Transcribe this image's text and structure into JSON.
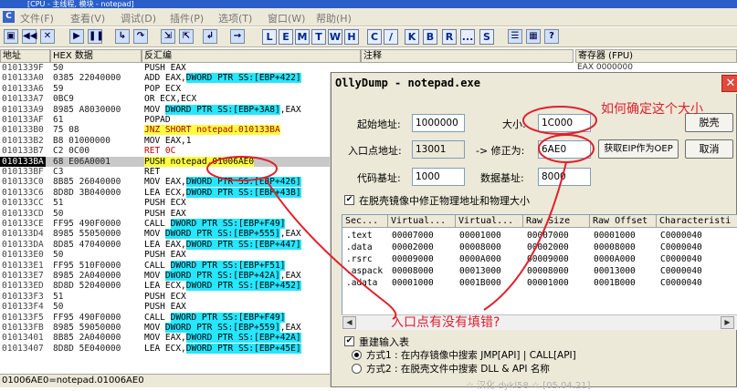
{
  "app_title": "[CPU - 主线程, 模块 - notepad]",
  "menu": [
    "文件(F)",
    "查看(V)",
    "调试(D)",
    "插件(P)",
    "选项(T)",
    "窗口(W)",
    "帮助(H)"
  ],
  "toolbar_letters": [
    "L",
    "E",
    "M",
    "T",
    "W",
    "H",
    "C",
    "/",
    "K",
    "B",
    "R",
    "...",
    "S"
  ],
  "columns": {
    "addr": "地址",
    "hex": "HEX 数据",
    "dis": "反汇编",
    "comment": "注释",
    "reg": "寄存器 (FPU)"
  },
  "reg_first": "EAX 0000000",
  "rows": [
    {
      "a": "0101339F",
      "h": "50",
      "d": "PUSH EAX"
    },
    {
      "a": "010133A0",
      "h": "0385 22040000",
      "d": "ADD EAX,",
      "dh": "DWORD PTR SS:[EBP+422]"
    },
    {
      "a": "010133A6",
      "h": "59",
      "d": "POP ECX"
    },
    {
      "a": "010133A7",
      "h": "0BC9",
      "d": "OR ECX,ECX"
    },
    {
      "a": "010133A9",
      "h": "8985 A8030000",
      "d": "MOV ",
      "dh": "DWORD PTR SS:[EBP+3A8]",
      "dt": ",EAX"
    },
    {
      "a": "010133AF",
      "h": "61",
      "d": "POPAD"
    },
    {
      "a": "010133B0",
      "h": "75 08",
      "d": "JNZ SHORT notepad.010133BA",
      "y": true
    },
    {
      "a": "010133B2",
      "h": "B8 01000000",
      "d": "MOV EAX,1"
    },
    {
      "a": "010133B7",
      "h": "C2 0C00",
      "d": "RET 0C",
      "red": true
    },
    {
      "a": "010133BA",
      "h": "68 E06A0001",
      "d": "PUSH notepad.01006AE0",
      "sel": true
    },
    {
      "a": "010133BF",
      "h": "C3",
      "d": "RET"
    },
    {
      "a": "010133C0",
      "h": "8B85 26040000",
      "d": "MOV EAX,",
      "dh": "DWORD PTR SS:[EBP+426]"
    },
    {
      "a": "010133C6",
      "h": "8D8D 3B040000",
      "d": "LEA ECX,",
      "dh": "DWORD PTR SS:[EBP+43B]"
    },
    {
      "a": "010133CC",
      "h": "51",
      "d": "PUSH ECX"
    },
    {
      "a": "010133CD",
      "h": "50",
      "d": "PUSH EAX"
    },
    {
      "a": "010133CE",
      "h": "FF95 490F0000",
      "d": "CALL ",
      "dh": "DWORD PTR SS:[EBP+F49]"
    },
    {
      "a": "010133D4",
      "h": "8985 55050000",
      "d": "MOV ",
      "dh": "DWORD PTR SS:[EBP+555]",
      "dt": ",EAX"
    },
    {
      "a": "010133DA",
      "h": "8D85 47040000",
      "d": "LEA EAX,",
      "dh": "DWORD PTR SS:[EBP+447]"
    },
    {
      "a": "010133E0",
      "h": "50",
      "d": "PUSH EAX"
    },
    {
      "a": "010133E1",
      "h": "FF95 510F0000",
      "d": "CALL ",
      "dh": "DWORD PTR SS:[EBP+F51]"
    },
    {
      "a": "010133E7",
      "h": "8985 2A040000",
      "d": "MOV ",
      "dh": "DWORD PTR SS:[EBP+42A]",
      "dt": ",EAX"
    },
    {
      "a": "010133ED",
      "h": "8D8D 52040000",
      "d": "LEA ECX,",
      "dh": "DWORD PTR SS:[EBP+452]"
    },
    {
      "a": "010133F3",
      "h": "51",
      "d": "PUSH ECX"
    },
    {
      "a": "010133F4",
      "h": "50",
      "d": "PUSH EAX"
    },
    {
      "a": "010133F5",
      "h": "FF95 490F0000",
      "d": "CALL ",
      "dh": "DWORD PTR SS:[EBP+F49]"
    },
    {
      "a": "010133FB",
      "h": "8985 59050000",
      "d": "MOV ",
      "dh": "DWORD PTR SS:[EBP+559]",
      "dt": ",EAX"
    },
    {
      "a": "01013401",
      "h": "8B85 2A040000",
      "d": "MOV EAX,",
      "dh": "DWORD PTR SS:[EBP+42A]"
    },
    {
      "a": "01013407",
      "h": "8D8D 5E040000",
      "d": "LEA ECX,",
      "dh": "DWORD PTR SS:[EBP+45E]"
    }
  ],
  "status": "01006AE0=notepad.01006AE0",
  "dialog": {
    "title": "OllyDump - notepad.exe",
    "start_label": "起始地址:",
    "start_value": "1000000",
    "size_label": "大小:",
    "size_value": "1C000",
    "entry_label": "入口点地址:",
    "entry_value": "13001",
    "fix_label": "-> 修正为:",
    "fix_value": "6AE0",
    "code_label": "代码基址:",
    "code_value": "1000",
    "data_label": "数据基址:",
    "data_value": "8000",
    "btn_dump": "脱壳",
    "btn_eip": "获取EIP作为OEP",
    "btn_cancel": "取消",
    "chk_fix": "在脱壳镜像中修正物理地址和物理大小",
    "table_headers": [
      "Sec...",
      "Virtual...",
      "Virtual...",
      "Raw Size",
      "Raw Offset",
      "Characteristi"
    ],
    "sections": [
      [
        ".text",
        "00007000",
        "00001000",
        "00007000",
        "00001000",
        "C0000040"
      ],
      [
        ".data",
        "00002000",
        "00008000",
        "00002000",
        "00008000",
        "C0000040"
      ],
      [
        ".rsrc",
        "00009000",
        "0000A000",
        "00009000",
        "0000A000",
        "C0000040"
      ],
      [
        ".aspack",
        "00008000",
        "00013000",
        "00008000",
        "00013000",
        "C0000040"
      ],
      [
        ".adata",
        "00001000",
        "0001B000",
        "00001000",
        "0001B000",
        "C0000040"
      ]
    ],
    "rebuild_label": "重建输入表",
    "method1": "方式1 : 在内存镜像中搜索 JMP[API] | CALL[API]",
    "method2": "方式2 : 在脱壳文件中搜索 DLL & API 名称"
  },
  "annotations": {
    "size_q": "如何确定这个大小",
    "entry_q": "入口点有没有填错?"
  },
  "watermark": "☆ 汉化 dykl58 ☆ [05.04.21]"
}
